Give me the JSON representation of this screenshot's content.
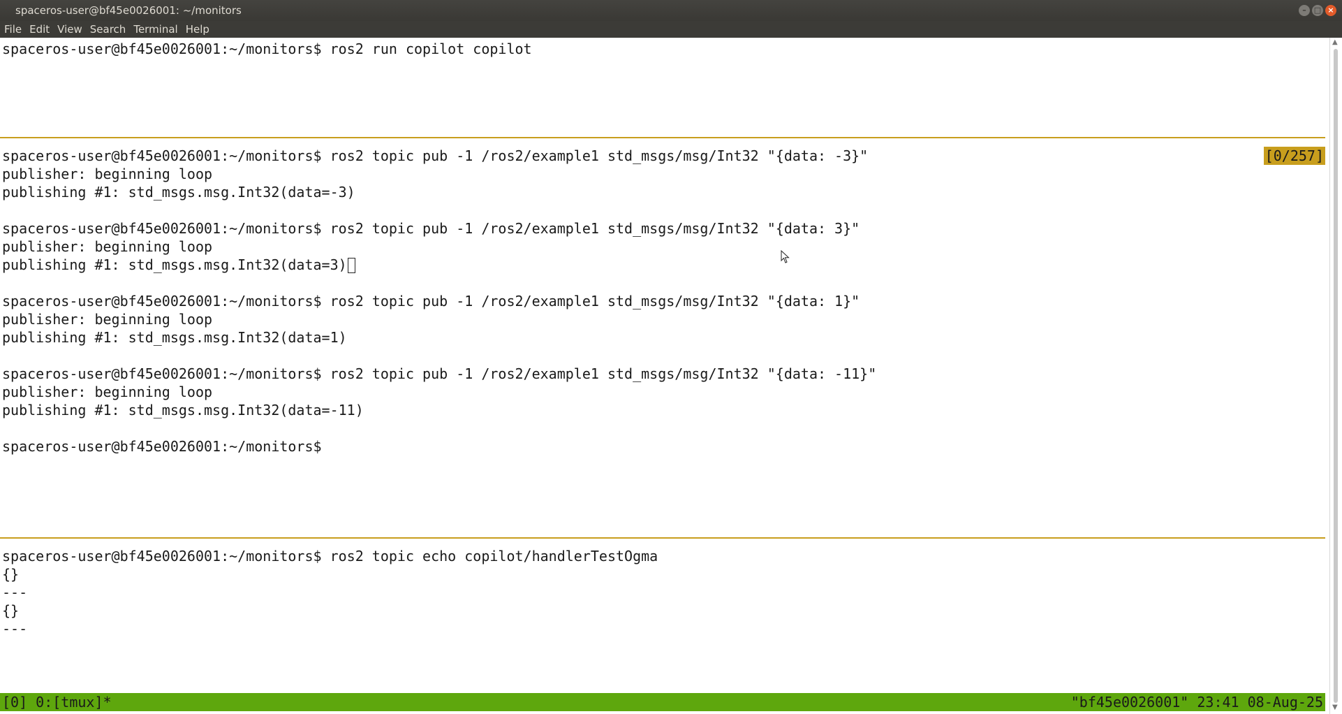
{
  "window": {
    "title": "spaceros-user@bf45e0026001: ~/monitors",
    "buttons": {
      "minimize": "–",
      "maximize": "□",
      "close": "×"
    }
  },
  "menubar": {
    "items": [
      "File",
      "Edit",
      "View",
      "Search",
      "Terminal",
      "Help"
    ]
  },
  "panes": {
    "top": {
      "lines": [
        "spaceros-user@bf45e0026001:~/monitors$ ros2 run copilot copilot"
      ]
    },
    "middle": {
      "indicator": "[0/257]",
      "lines": [
        "spaceros-user@bf45e0026001:~/monitors$ ros2 topic pub -1 /ros2/example1 std_msgs/msg/Int32 \"{data: -3}\"",
        "publisher: beginning loop",
        "publishing #1: std_msgs.msg.Int32(data=-3)",
        "",
        "spaceros-user@bf45e0026001:~/monitors$ ros2 topic pub -1 /ros2/example1 std_msgs/msg/Int32 \"{data: 3}\"",
        "publisher: beginning loop",
        "publishing #1: std_msgs.msg.Int32(data=3)",
        "",
        "spaceros-user@bf45e0026001:~/monitors$ ros2 topic pub -1 /ros2/example1 std_msgs/msg/Int32 \"{data: 1}\"",
        "publisher: beginning loop",
        "publishing #1: std_msgs.msg.Int32(data=1)",
        "",
        "spaceros-user@bf45e0026001:~/monitors$ ros2 topic pub -1 /ros2/example1 std_msgs/msg/Int32 \"{data: -11}\"",
        "publisher: beginning loop",
        "publishing #1: std_msgs.msg.Int32(data=-11)",
        "",
        "spaceros-user@bf45e0026001:~/monitors$"
      ]
    },
    "bottom": {
      "lines": [
        "spaceros-user@bf45e0026001:~/monitors$ ros2 topic echo copilot/handlerTestOgma",
        "{}",
        "---",
        "{}",
        "---"
      ]
    }
  },
  "statusbar": {
    "left": "[0] 0:[tmux]*",
    "right": "\"bf45e0026001\" 23:41 08-Aug-25"
  },
  "colors": {
    "tmux_status": "#5ea70d",
    "pane_border": "#c89e1d",
    "titlebar": "#3c3b37",
    "close_button": "#e35b2a"
  }
}
